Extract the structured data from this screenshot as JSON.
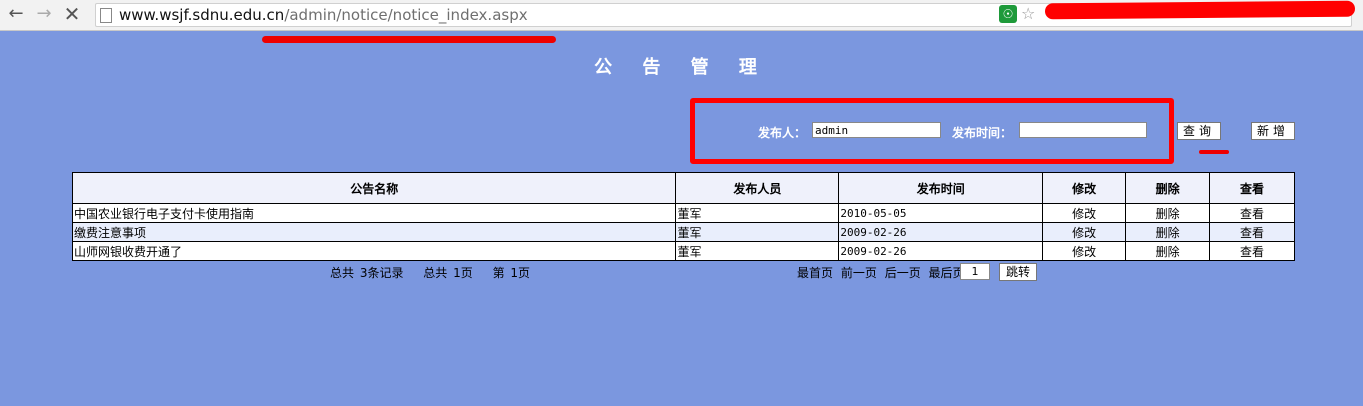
{
  "browser": {
    "url_host": "www.wsjf.sdnu.edu.cn",
    "url_path": "/admin/notice/notice_index.aspx"
  },
  "page": {
    "title": "公 告 管 理"
  },
  "search": {
    "publisher_label": "发布人：",
    "publisher_value": "admin",
    "time_label": "发布时间：",
    "time_value": "",
    "query_button": "查询",
    "add_button": "新增"
  },
  "table": {
    "headers": [
      "公告名称",
      "发布人员",
      "发布时间",
      "修改",
      "删除",
      "查看"
    ],
    "rows": [
      {
        "name": "中国农业银行电子支付卡使用指南",
        "publisher": "董军",
        "date": "2010-05-05",
        "edit": "修改",
        "delete": "删除",
        "view": "查看"
      },
      {
        "name": "缴费注意事项",
        "publisher": "董军",
        "date": "2009-02-26",
        "edit": "修改",
        "delete": "删除",
        "view": "查看"
      },
      {
        "name": "山师网银收费开通了",
        "publisher": "董军",
        "date": "2009-02-26",
        "edit": "修改",
        "delete": "删除",
        "view": "查看"
      }
    ]
  },
  "footer": {
    "total_records": "总共 3条记录",
    "total_pages": "总共 1页",
    "current_page": "第 1页",
    "first": "最首页",
    "prev": "前一页",
    "next": "后一页",
    "last": "最后页",
    "page_value": "1",
    "jump": "跳转"
  }
}
